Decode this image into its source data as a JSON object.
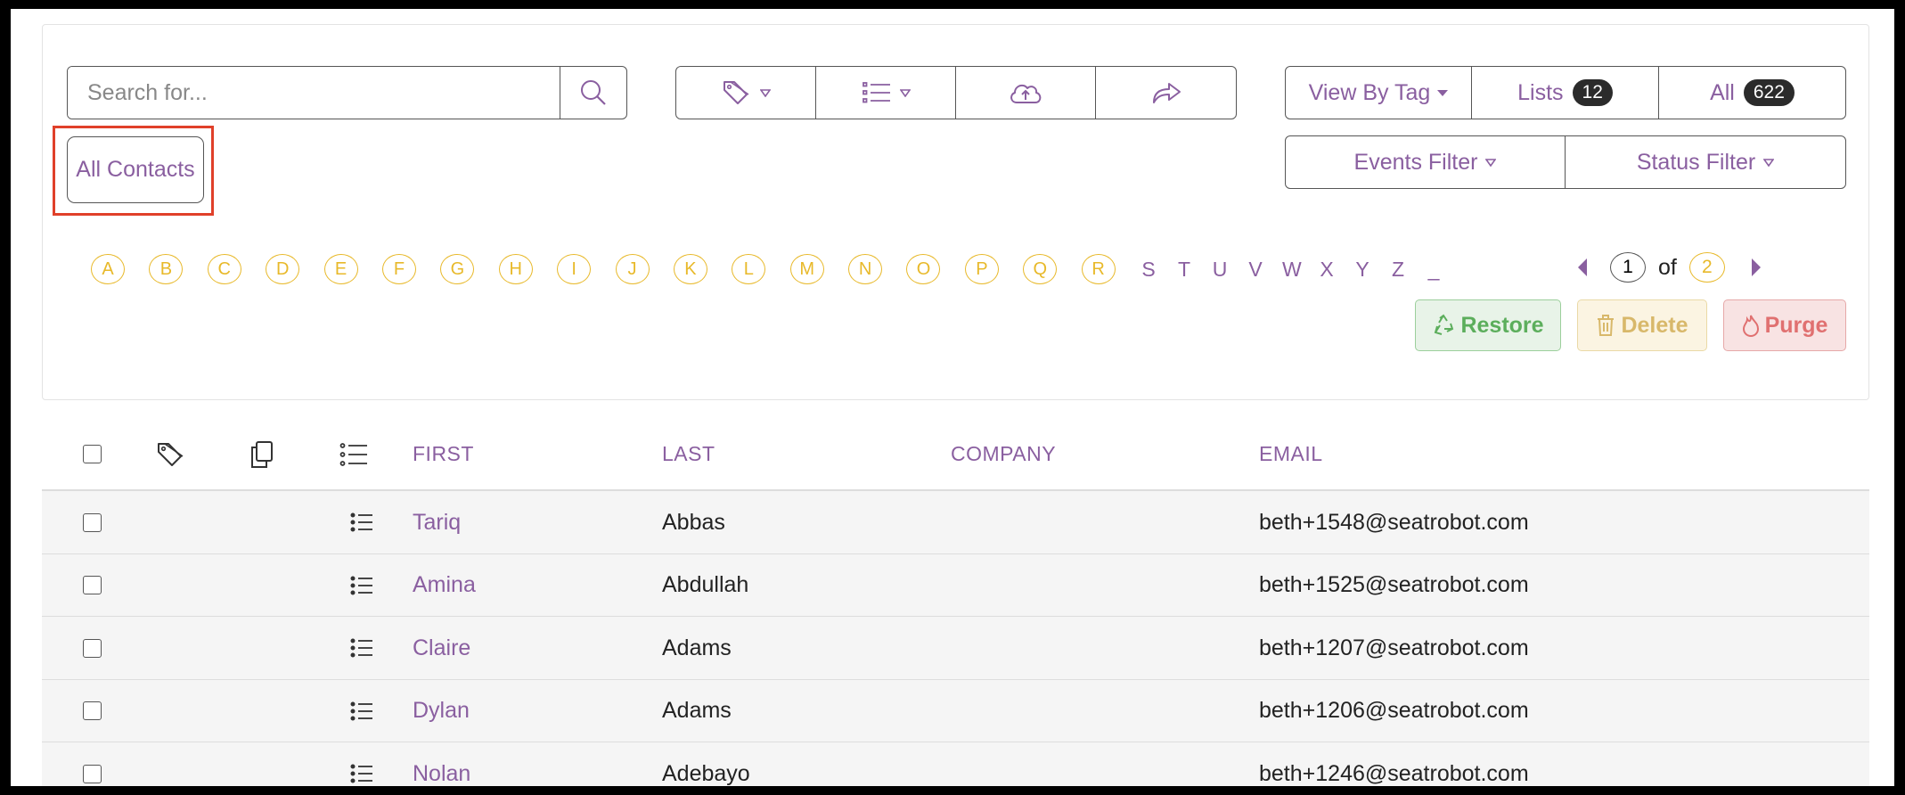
{
  "search": {
    "placeholder": "Search for..."
  },
  "toolbar": {
    "icons": [
      "tag-icon",
      "list-icon",
      "cloud-upload-icon",
      "share-icon"
    ]
  },
  "view_controls": {
    "view_by_tag": "View By Tag",
    "lists_label": "Lists",
    "lists_count": "12",
    "all_label": "All",
    "all_count": "622",
    "events_filter": "Events Filter",
    "status_filter": "Status Filter"
  },
  "all_contacts_label": "All Contacts",
  "alphabet_circled": [
    "A",
    "B",
    "C",
    "D",
    "E",
    "F",
    "G",
    "H",
    "I",
    "J",
    "K",
    "L",
    "M",
    "N",
    "O",
    "P",
    "Q",
    "R"
  ],
  "alphabet_plain": [
    "S",
    "T",
    "U",
    "V",
    "W",
    "X",
    "Y",
    "Z",
    "_"
  ],
  "pagination": {
    "current": "1",
    "of": "of",
    "total": "2"
  },
  "actions": {
    "restore": "Restore",
    "delete": "Delete",
    "purge": "Purge"
  },
  "colors": {
    "accent": "#8a5fa0",
    "letter": "#e8b92a",
    "restore": "#5cae5c",
    "delete": "#d8b86a",
    "purge": "#e07070"
  },
  "table": {
    "headers": {
      "first": "FIRST",
      "last": "LAST",
      "company": "COMPANY",
      "email": "EMAIL"
    },
    "rows": [
      {
        "first": "Tariq",
        "last": "Abbas",
        "company": "",
        "email": "beth+1548@seatrobot.com"
      },
      {
        "first": "Amina",
        "last": "Abdullah",
        "company": "",
        "email": "beth+1525@seatrobot.com"
      },
      {
        "first": "Claire",
        "last": "Adams",
        "company": "",
        "email": "beth+1207@seatrobot.com"
      },
      {
        "first": "Dylan",
        "last": "Adams",
        "company": "",
        "email": "beth+1206@seatrobot.com"
      },
      {
        "first": "Nolan",
        "last": "Adebayo",
        "company": "",
        "email": "beth+1246@seatrobot.com"
      }
    ]
  }
}
